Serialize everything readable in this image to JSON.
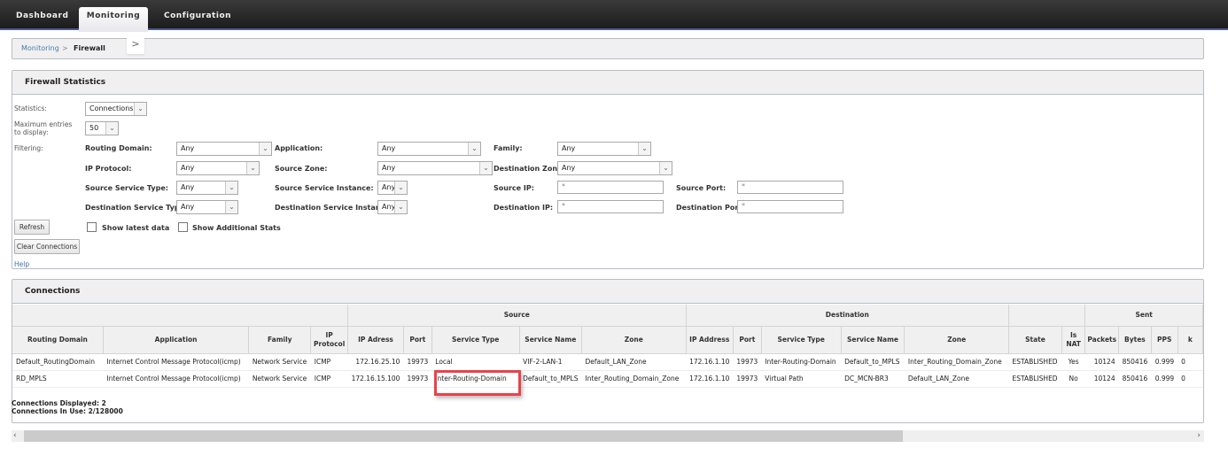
{
  "nav": {
    "tabs": [
      {
        "label": "Dashboard",
        "active": false
      },
      {
        "label": "Monitoring",
        "active": true
      },
      {
        "label": "Configuration",
        "active": false
      }
    ]
  },
  "breadcrumb": {
    "parent": "Monitoring",
    "separator": ">",
    "current": "Firewall",
    "toggle_glyph": ">"
  },
  "stats_panel": {
    "title": "Firewall Statistics",
    "statistics_label": "Statistics:",
    "statistics_value": "Connections",
    "max_entries_label": "Maximum entries to display:",
    "max_entries_value": "50",
    "filtering_label": "Filtering:",
    "filters": {
      "routing_domain": {
        "label": "Routing Domain:",
        "value": "Any"
      },
      "application": {
        "label": "Application:",
        "value": "Any"
      },
      "family": {
        "label": "Family:",
        "value": "Any"
      },
      "ip_protocol": {
        "label": "IP Protocol:",
        "value": "Any"
      },
      "source_zone": {
        "label": "Source Zone:",
        "value": "Any"
      },
      "destination_zone": {
        "label": "Destination Zone:",
        "value": "Any"
      },
      "source_service_type": {
        "label": "Source Service Type:",
        "value": "Any"
      },
      "source_service_instance": {
        "label": "Source Service Instance:",
        "value": "Any"
      },
      "source_ip": {
        "label": "Source IP:",
        "value": "*"
      },
      "source_port": {
        "label": "Source Port:",
        "value": "*"
      },
      "destination_service_type": {
        "label": "Destination Service Type:",
        "value": "Any"
      },
      "destination_service_instance": {
        "label": "Destination Service Instance:",
        "value": "Any"
      },
      "destination_ip": {
        "label": "Destination IP:",
        "value": "*"
      },
      "destination_port": {
        "label": "Destination Port:",
        "value": "*"
      }
    },
    "refresh_label": "Refresh",
    "clear_label": "Clear Connections",
    "show_latest_label": "Show latest data",
    "show_latest_checked": false,
    "show_additional_label": "Show Additional Stats",
    "show_additional_checked": false,
    "help_label": "Help"
  },
  "connections": {
    "title": "Connections",
    "groups": {
      "source": "Source",
      "destination": "Destination",
      "sent": "Sent"
    },
    "columns": [
      "Routing Domain",
      "Application",
      "Family",
      "IP Protocol",
      "IP Adress",
      "Port",
      "Service Type",
      "Service Name",
      "Zone",
      "IP Address",
      "Port",
      "Service Type",
      "Service Name",
      "Zone",
      "State",
      "Is NAT",
      "Packets",
      "Bytes",
      "PPS",
      "k"
    ],
    "rows": [
      [
        "Default_RoutingDomain",
        "Internet Control Message Protocol(icmp)",
        "Network Service",
        "ICMP",
        "172.16.25.10",
        "19973",
        "Local",
        "VIF-2-LAN-1",
        "Default_LAN_Zone",
        "172.16.1.10",
        "19973",
        "Inter-Routing-Domain",
        "Default_to_MPLS",
        "Inter_Routing_Domain_Zone",
        "ESTABLISHED",
        "Yes",
        "10124",
        "850416",
        "0.999",
        "0"
      ],
      [
        "RD_MPLS",
        "Internet Control Message Protocol(icmp)",
        "Network Service",
        "ICMP",
        "172.16.15.100",
        "19973",
        "Inter-Routing-Domain",
        "Default_to_MPLS",
        "Inter_Routing_Domain_Zone",
        "172.16.1.10",
        "19973",
        "Virtual Path",
        "DC_MCN-BR3",
        "Default_LAN_Zone",
        "ESTABLISHED",
        "No",
        "10124",
        "850416",
        "0.999",
        "0"
      ]
    ],
    "displayed": "Connections Displayed: 2",
    "in_use": "Connections In Use: 2/128000"
  },
  "scrollbar": {
    "left_glyph": "‹",
    "right_glyph": "›"
  },
  "colors": {
    "highlight": "#e8434a",
    "link": "#3a72b0"
  }
}
